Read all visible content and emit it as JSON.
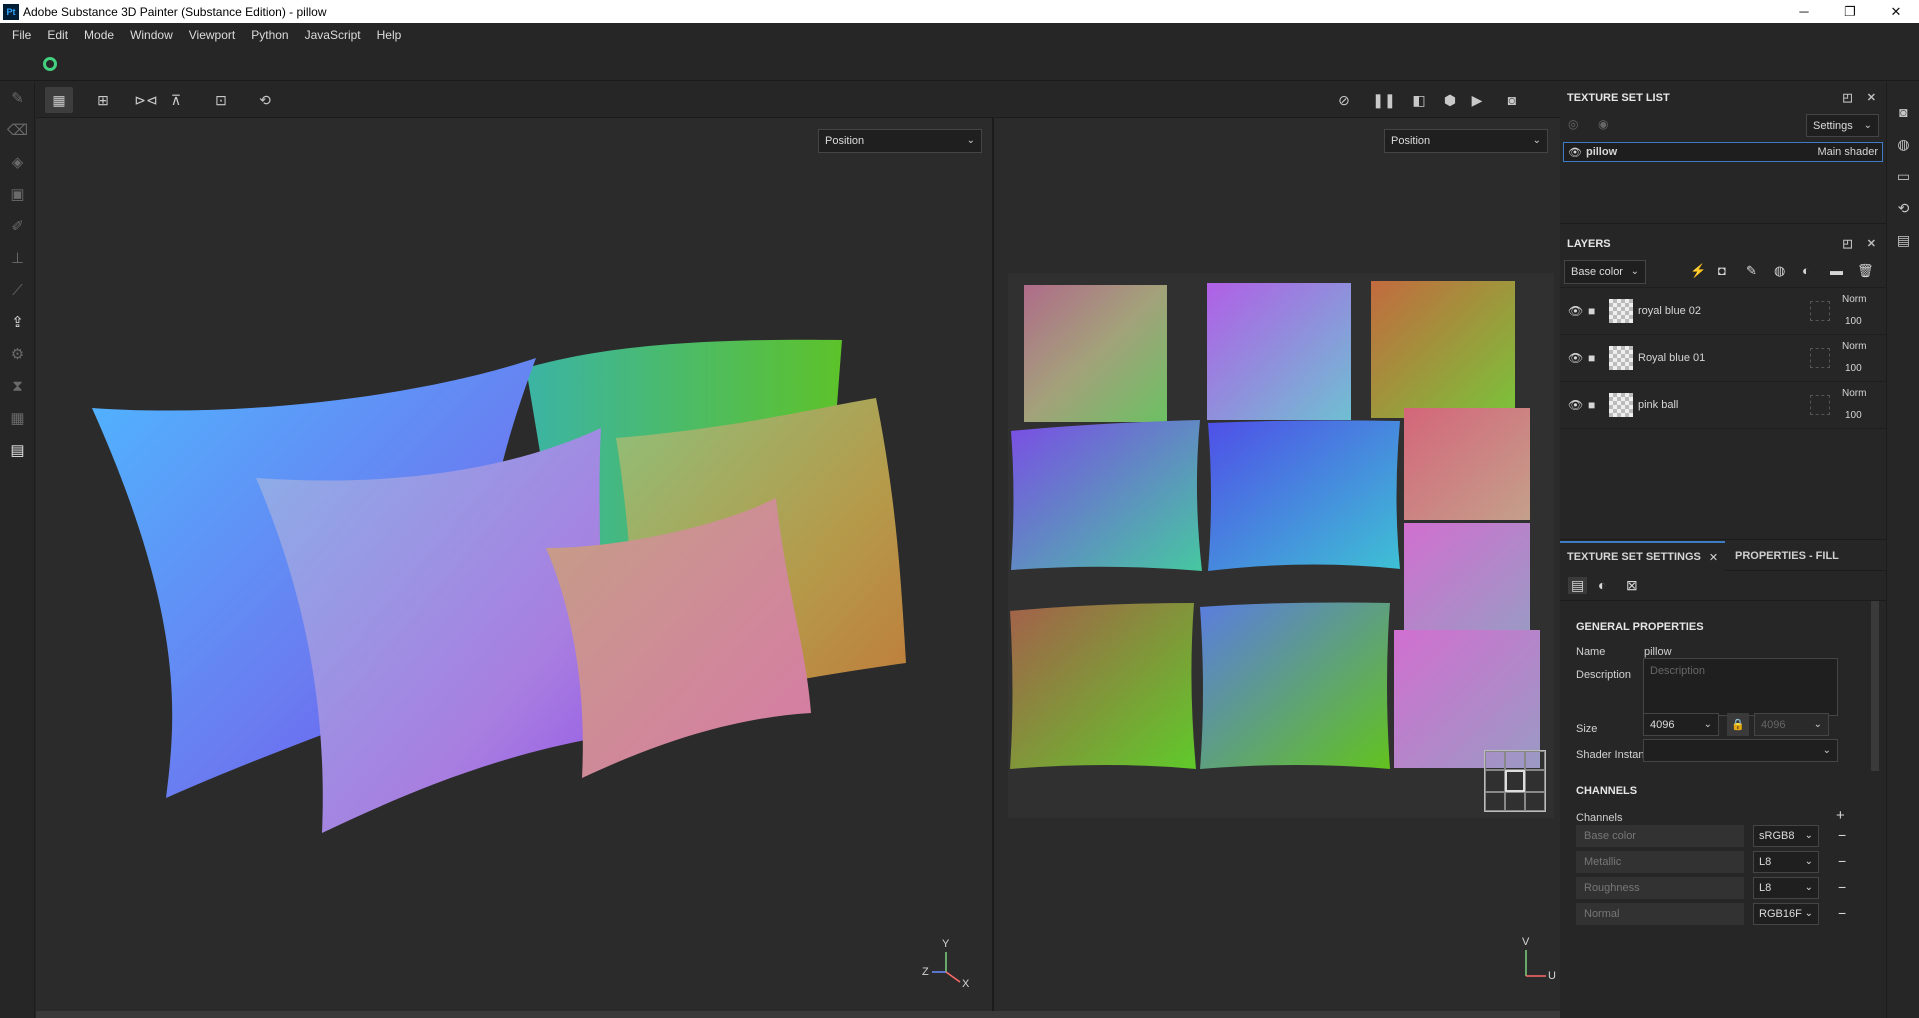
{
  "window": {
    "app_icon": "Pt",
    "title": "Adobe Substance 3D Painter (Substance Edition) - pillow",
    "minimize": "─",
    "maximize": "❐",
    "close": "✕"
  },
  "menu": [
    "File",
    "Edit",
    "Mode",
    "Window",
    "Viewport",
    "Python",
    "JavaScript",
    "Help"
  ],
  "viewport": {
    "left_mode": "Position",
    "right_mode": "Position",
    "axes_3d": {
      "y": "Y",
      "z": "Z",
      "x": "X"
    },
    "axes_uv": {
      "v": "V",
      "u": "U"
    }
  },
  "texture_set_list": {
    "title": "TEXTURE SET LIST",
    "settings_label": "Settings",
    "items": [
      {
        "name": "pillow",
        "shader": "Main shader"
      }
    ]
  },
  "layers": {
    "title": "LAYERS",
    "channel": "Base color",
    "items": [
      {
        "name": "royal blue 02",
        "blend": "Norm",
        "opacity": "100"
      },
      {
        "name": "Royal blue 01",
        "blend": "Norm",
        "opacity": "100"
      },
      {
        "name": "pink ball",
        "blend": "Norm",
        "opacity": "100"
      }
    ]
  },
  "tabs": {
    "texture_set_settings": "TEXTURE SET SETTINGS",
    "properties_fill": "PROPERTIES - FILL"
  },
  "general": {
    "heading": "GENERAL PROPERTIES",
    "name_label": "Name",
    "name_value": "pillow",
    "description_label": "Description",
    "description_placeholder": "Description",
    "size_label": "Size",
    "size_value": "4096",
    "size_value_2": "4096",
    "shader_label": "Shader Instance",
    "shader_value": ""
  },
  "channels": {
    "heading": "CHANNELS",
    "label": "Channels",
    "items": [
      {
        "name": "Base color",
        "format": "sRGB8"
      },
      {
        "name": "Metallic",
        "format": "L8"
      },
      {
        "name": "Roughness",
        "format": "L8"
      },
      {
        "name": "Normal",
        "format": "RGB16F"
      }
    ]
  }
}
